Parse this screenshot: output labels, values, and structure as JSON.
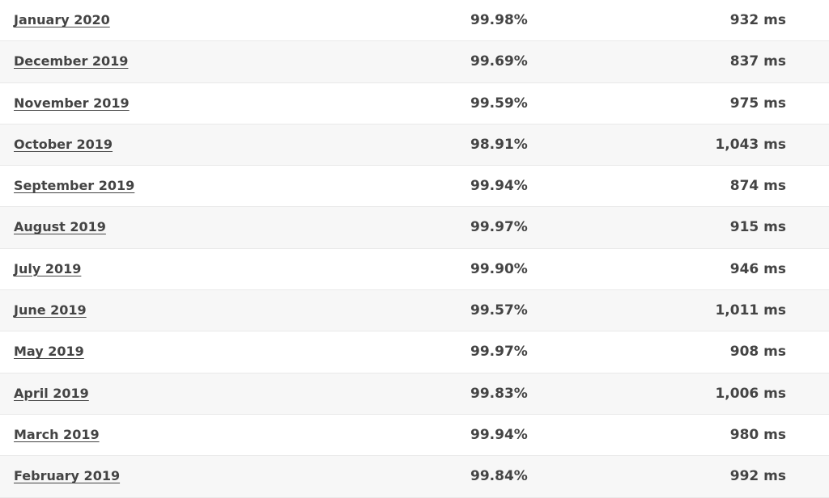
{
  "table": {
    "rows": [
      {
        "month": "January 2020",
        "uptime": "99.98%",
        "response": "932 ms"
      },
      {
        "month": "December 2019",
        "uptime": "99.69%",
        "response": "837 ms"
      },
      {
        "month": "November 2019",
        "uptime": "99.59%",
        "response": "975 ms"
      },
      {
        "month": "October 2019",
        "uptime": "98.91%",
        "response": "1,043 ms"
      },
      {
        "month": "September 2019",
        "uptime": "99.94%",
        "response": "874 ms"
      },
      {
        "month": "August 2019",
        "uptime": "99.97%",
        "response": "915 ms"
      },
      {
        "month": "July 2019",
        "uptime": "99.90%",
        "response": "946 ms"
      },
      {
        "month": "June 2019",
        "uptime": "99.57%",
        "response": "1,011 ms"
      },
      {
        "month": "May 2019",
        "uptime": "99.97%",
        "response": "908 ms"
      },
      {
        "month": "April 2019",
        "uptime": "99.83%",
        "response": "1,006 ms"
      },
      {
        "month": "March 2019",
        "uptime": "99.94%",
        "response": "980 ms"
      },
      {
        "month": "February 2019",
        "uptime": "99.84%",
        "response": "992 ms"
      }
    ]
  }
}
